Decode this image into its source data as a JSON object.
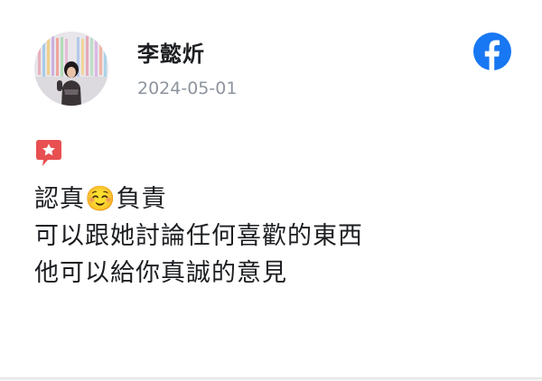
{
  "review": {
    "reviewer_name": "李懿炘",
    "date": "2024-05-01",
    "platform_icon": "facebook-icon",
    "badge_icon": "recommend-star-icon",
    "lines": [
      "認真☺️負責",
      "可以跟她討論任何喜歡的東西",
      "他可以給你真誠的意見"
    ]
  },
  "colors": {
    "facebook_blue": "#1877f2",
    "badge_red": "#e84f50",
    "date_gray": "#8d949e",
    "text": "#1c1e21"
  }
}
